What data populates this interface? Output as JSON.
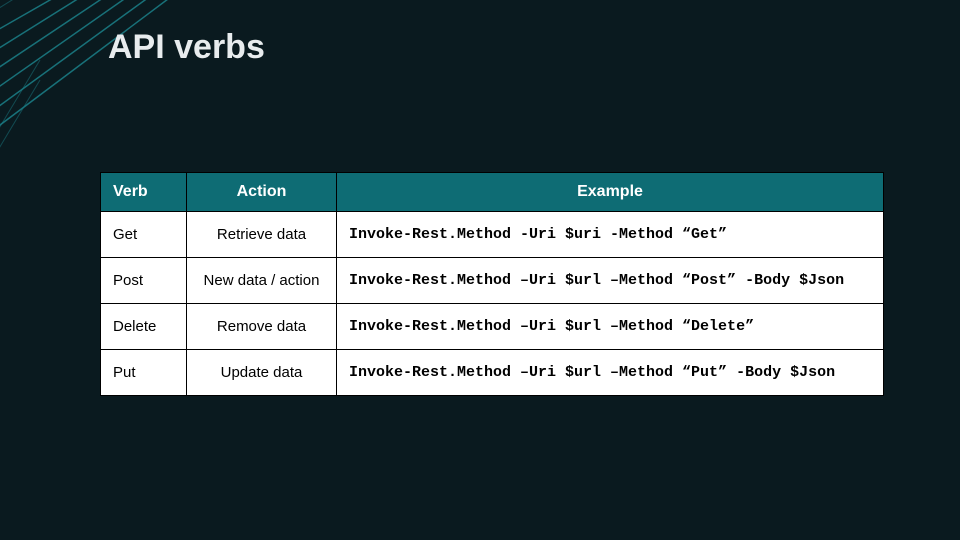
{
  "title": "API verbs",
  "table": {
    "headers": {
      "verb": "Verb",
      "action": "Action",
      "example": "Example"
    },
    "rows": [
      {
        "verb": "Get",
        "action": "Retrieve data",
        "example": "Invoke-Rest.Method -Uri $uri -Method “Get”"
      },
      {
        "verb": "Post",
        "action": "New data / action",
        "example": "Invoke-Rest.Method –Uri $url –Method “Post” -Body $Json"
      },
      {
        "verb": "Delete",
        "action": "Remove data",
        "example": "Invoke-Rest.Method –Uri $url –Method “Delete”"
      },
      {
        "verb": "Put",
        "action": "Update data",
        "example": "Invoke-Rest.Method –Uri $url –Method “Put” -Body $Json"
      }
    ]
  }
}
